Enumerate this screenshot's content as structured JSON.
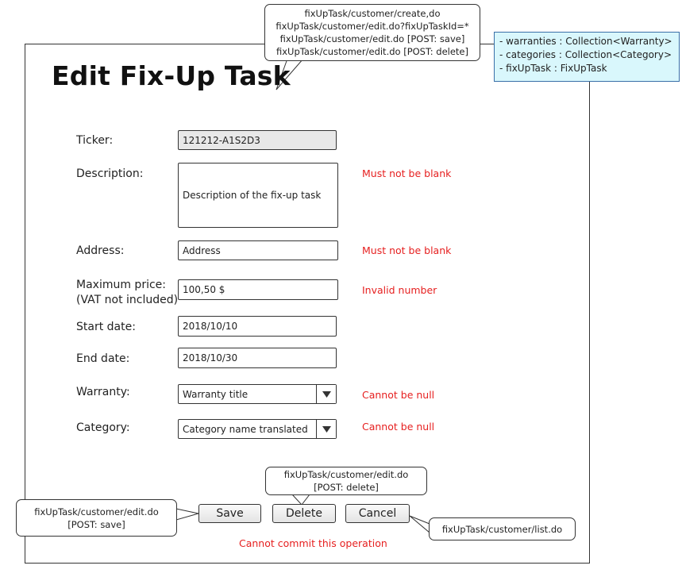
{
  "page": {
    "title": "Edit Fix-Up Task"
  },
  "model_note": {
    "lines": [
      "- warranties : Collection<Warranty>",
      "- categories : Collection<Category>",
      "- fixUpTask : FixUpTask"
    ]
  },
  "url_callouts": {
    "top": [
      "fixUpTask/customer/create,do",
      "fixUpTask/customer/edit.do?fixUpTaskId=*",
      "fixUpTask/customer/edit.do [POST: save]",
      "fixUpTask/customer/edit.do [POST: delete]"
    ],
    "save": [
      "fixUpTask/customer/edit.do",
      "[POST: save]"
    ],
    "delete": [
      "fixUpTask/customer/edit.do",
      "[POST: delete]"
    ],
    "cancel": [
      "fixUpTask/customer/list.do"
    ]
  },
  "form": {
    "ticker": {
      "label": "Ticker:",
      "value": "121212-A1S2D3"
    },
    "description": {
      "label": "Description:",
      "value": "Description of the fix-up task",
      "error": "Must not be blank"
    },
    "address": {
      "label": "Address:",
      "value": "Address",
      "error": "Must not be blank"
    },
    "max_price": {
      "label": "Maximum price:",
      "sublabel": "(VAT not included)",
      "value": "100,50 $",
      "error": "Invalid number"
    },
    "start_date": {
      "label": "Start date:",
      "value": "2018/10/10"
    },
    "end_date": {
      "label": "End date:",
      "value": "2018/10/30"
    },
    "warranty": {
      "label": "Warranty:",
      "value": "Warranty title",
      "error": "Cannot be null"
    },
    "category": {
      "label": "Category:",
      "value": "Category name translated",
      "error": "Cannot be null"
    }
  },
  "actions": {
    "save_label": "Save",
    "delete_label": "Delete",
    "cancel_label": "Cancel",
    "commit_error": "Cannot commit this operation"
  },
  "icons": {
    "dropdown": "triangle-down-icon"
  },
  "colors": {
    "error": "#e62020",
    "note_bg": "#d9f7fc",
    "note_border": "#3a6fa8",
    "readonly_bg": "#e8e8e8"
  }
}
